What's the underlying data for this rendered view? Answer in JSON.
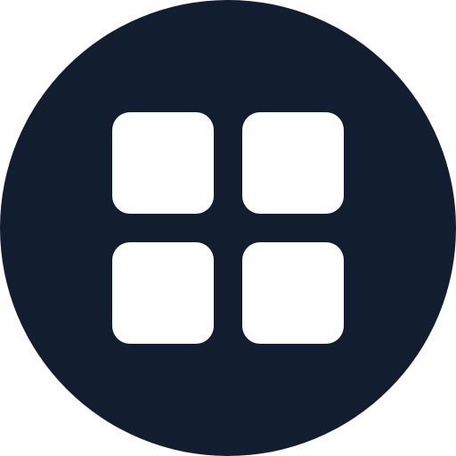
{
  "icon": {
    "name": "grid-menu-icon",
    "shape": "four-rounded-squares-in-circle",
    "colors": {
      "background": "#121e30",
      "foreground": "#ffffff"
    }
  }
}
